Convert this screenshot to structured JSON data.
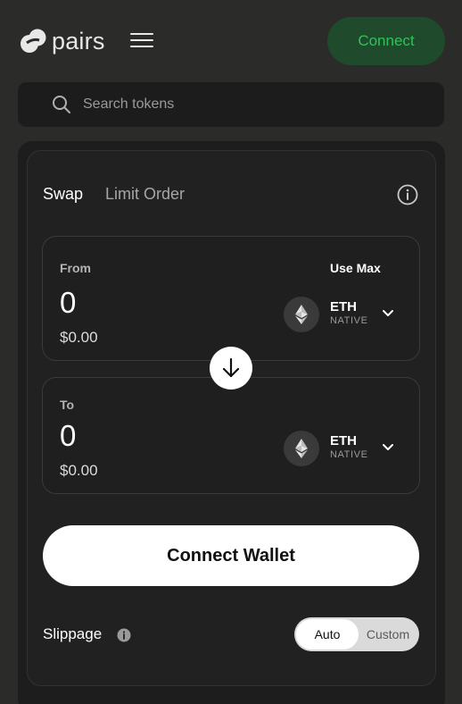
{
  "header": {
    "logo_text": "pairs",
    "connect_label": "Connect"
  },
  "search": {
    "placeholder": "Search tokens"
  },
  "tabs": {
    "swap": "Swap",
    "limit_order": "Limit Order"
  },
  "from": {
    "label": "From",
    "use_max": "Use Max",
    "amount": "0",
    "usd": "$0.00",
    "token": {
      "symbol": "ETH",
      "sub": "NATIVE"
    }
  },
  "to": {
    "label": "To",
    "amount": "0",
    "usd": "$0.00",
    "token": {
      "symbol": "ETH",
      "sub": "NATIVE"
    }
  },
  "wallet_button": "Connect Wallet",
  "slippage": {
    "label": "Slippage",
    "options": [
      "Auto",
      "Custom"
    ],
    "selected": "Auto"
  },
  "colors": {
    "background": "#2b2b2a",
    "connect_bg": "#1f4a2c",
    "connect_text": "#2fc25a"
  },
  "icons": [
    "logo-mark",
    "menu-icon",
    "search-icon",
    "info-icon",
    "eth-icon",
    "chevron-down-icon",
    "arrow-down-icon"
  ]
}
